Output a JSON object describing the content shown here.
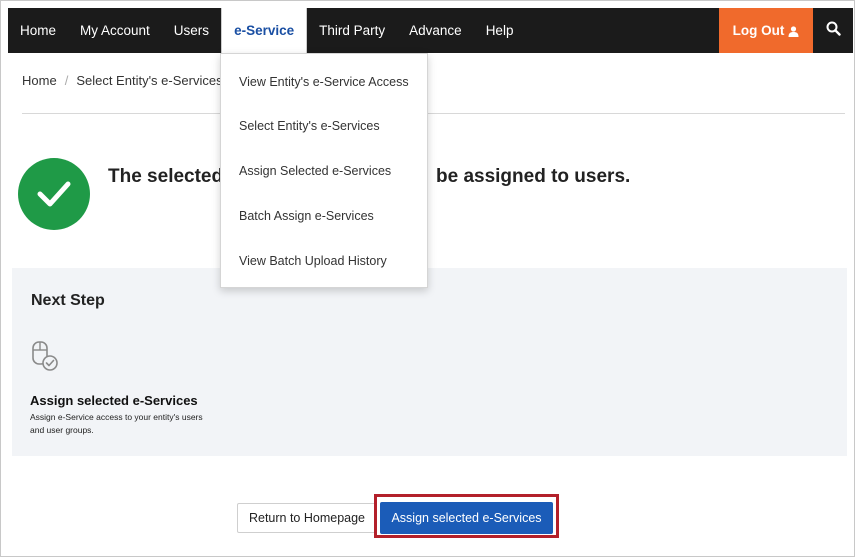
{
  "nav": {
    "items": [
      "Home",
      "My Account",
      "Users",
      "e-Service",
      "Third Party",
      "Advance",
      "Help"
    ],
    "active_index": 3,
    "logout_label": "Log Out",
    "logout_color": "#f06a2c",
    "bar_color": "#1b1b1b"
  },
  "breadcrumb": {
    "home": "Home",
    "current": "Select Entity's e-Services"
  },
  "dropdown": {
    "items": [
      "View Entity's e-Service Access",
      "Select Entity's e-Services",
      "Assign Selected e-Services",
      "Batch Assign e-Services",
      "View Batch Upload History"
    ]
  },
  "success": {
    "visible_left": "The selected",
    "visible_right": "be assigned to users.",
    "color": "#1f9a47"
  },
  "next_step": {
    "heading": "Next Step",
    "title": "Assign selected e-Services",
    "description": "Assign e-Service access to your entity's users and user groups."
  },
  "buttons": {
    "return_home": "Return to Homepage",
    "assign": "Assign selected e-Services",
    "assign_color": "#1b5cb8",
    "highlight_color": "#b3202a"
  },
  "icons": {
    "user": "user-icon",
    "search": "search-icon",
    "success": "check-circle-icon",
    "step": "mouse-check-icon"
  }
}
